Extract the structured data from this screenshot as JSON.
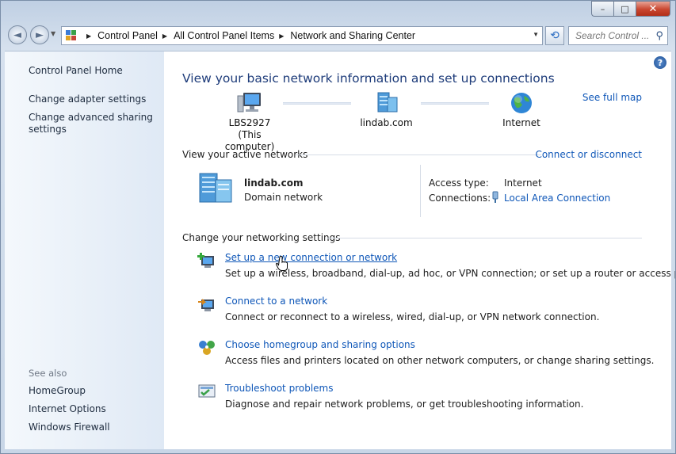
{
  "window": {
    "controls": {
      "minimize": "–",
      "maximize": "□",
      "close": "✕"
    }
  },
  "navbar": {
    "back_icon": "◄",
    "forward_icon": "►",
    "breadcrumb": [
      "Control Panel",
      "All Control Panel Items",
      "Network and Sharing Center"
    ],
    "search_placeholder": "Search Control ...",
    "refresh_icon": "⟲",
    "search_icon": "⚲"
  },
  "sidebar": {
    "home": "Control Panel Home",
    "items": [
      "Change adapter settings",
      "Change advanced sharing",
      "settings"
    ],
    "see_also_label": "See also",
    "see_also": [
      "HomeGroup",
      "Internet Options",
      "Windows Firewall"
    ]
  },
  "main": {
    "help": "?",
    "heading": "View your basic network information and set up connections",
    "see_full_map": "See full map",
    "map_nodes": [
      {
        "line1": "LBS2927",
        "line2": "(This computer)"
      },
      {
        "line1": "lindab.com"
      },
      {
        "line1": "Internet"
      }
    ],
    "active_title": "View your active networks",
    "connect_or_disconnect": "Connect or disconnect",
    "network": {
      "name": "lindab.com",
      "type": "Domain network",
      "access_type_label": "Access type:",
      "access_type_value": "Internet",
      "connections_label": "Connections:",
      "connections_value": "Local Area Connection"
    },
    "change_title": "Change your networking settings",
    "tasks": [
      {
        "link": "Set up a new connection or network",
        "desc": "Set up a wireless, broadband, dial-up, ad hoc, or VPN connection; or set up a router or access point."
      },
      {
        "link": "Connect to a network",
        "desc": "Connect or reconnect to a wireless, wired, dial-up, or VPN network connection."
      },
      {
        "link": "Choose homegroup and sharing options",
        "desc": "Access files and printers located on other network computers, or change sharing settings."
      },
      {
        "link": "Troubleshoot problems",
        "desc": "Diagnose and repair network problems, or get troubleshooting information."
      }
    ]
  }
}
